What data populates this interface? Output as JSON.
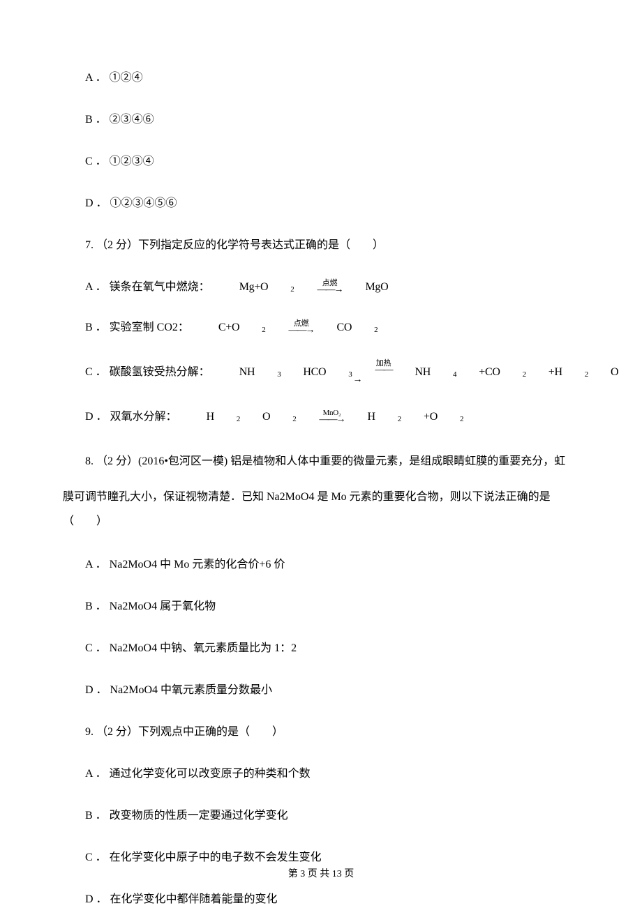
{
  "q6_options": {
    "a": "A ． ①②④",
    "b": "B ． ②③④⑥",
    "c": "C ． ①②③④",
    "d": "D ． ①②③④⑤⑥"
  },
  "q7": {
    "stem": "7. （2 分）下列指定反应的化学符号表达式正确的是（　　）",
    "a_label": "A ． 镁条在氧气中燃烧：",
    "a_formula_left": "Mg+O",
    "a_formula_left_sub": "2",
    "a_arrow_top": "点燃",
    "a_formula_right": "MgO",
    "b_label": "B ． 实验室制 CO2：",
    "b_formula_left": "C+O",
    "b_formula_left_sub": "2",
    "b_arrow_top": "点燃",
    "b_formula_right": "CO",
    "b_formula_right_sub": "2",
    "c_label": "C ． 碳酸氢铵受热分解：",
    "c_formula_p1": "NH",
    "c_formula_p1s": "3",
    "c_formula_p2": "HCO",
    "c_formula_p2s": "3",
    "c_arrow_top": "加热",
    "c_formula_p3": "NH",
    "c_formula_p3s": "4",
    "c_formula_p4": "+CO",
    "c_formula_p4s": "2",
    "c_formula_p5": "+H",
    "c_formula_p5s": "2",
    "c_formula_p6": "O",
    "d_label": "D ． 双氧水分解：",
    "d_formula_p1": "H",
    "d_formula_p1s": "2",
    "d_formula_p2": "O",
    "d_formula_p2s": "2",
    "d_arrow_top": "MnO₂",
    "d_formula_p3": "H",
    "d_formula_p3s": "2",
    "d_formula_p4": "+O",
    "d_formula_p4s": "2"
  },
  "q8": {
    "stem_line1": "8. （2 分）(2016•包河区一模) 铝是植物和人体中重要的微量元素，是组成眼睛虹膜的重要充分，虹",
    "stem_line2": "膜可调节瞳孔大小，保证视物清楚．已知 Na2MoO4 是 Mo 元素的重要化合物，则以下说法正确的是（　　）",
    "a": "A ． Na2MoO4 中 Mo 元素的化合价+6 价",
    "b": "B ． Na2MoO4 属于氧化物",
    "c": "C ． Na2MoO4 中钠、氧元素质量比为 1：2",
    "d": "D ． Na2MoO4 中氧元素质量分数最小"
  },
  "q9": {
    "stem": "9. （2 分）下列观点中正确的是（　　）",
    "a": "A ． 通过化学变化可以改变原子的种类和个数",
    "b": "B ． 改变物质的性质一定要通过化学变化",
    "c": "C ． 在化学变化中原子中的电子数不会发生变化",
    "d": "D ． 在化学变化中都伴随着能量的变化"
  },
  "footer": "第 3 页 共 13 页"
}
